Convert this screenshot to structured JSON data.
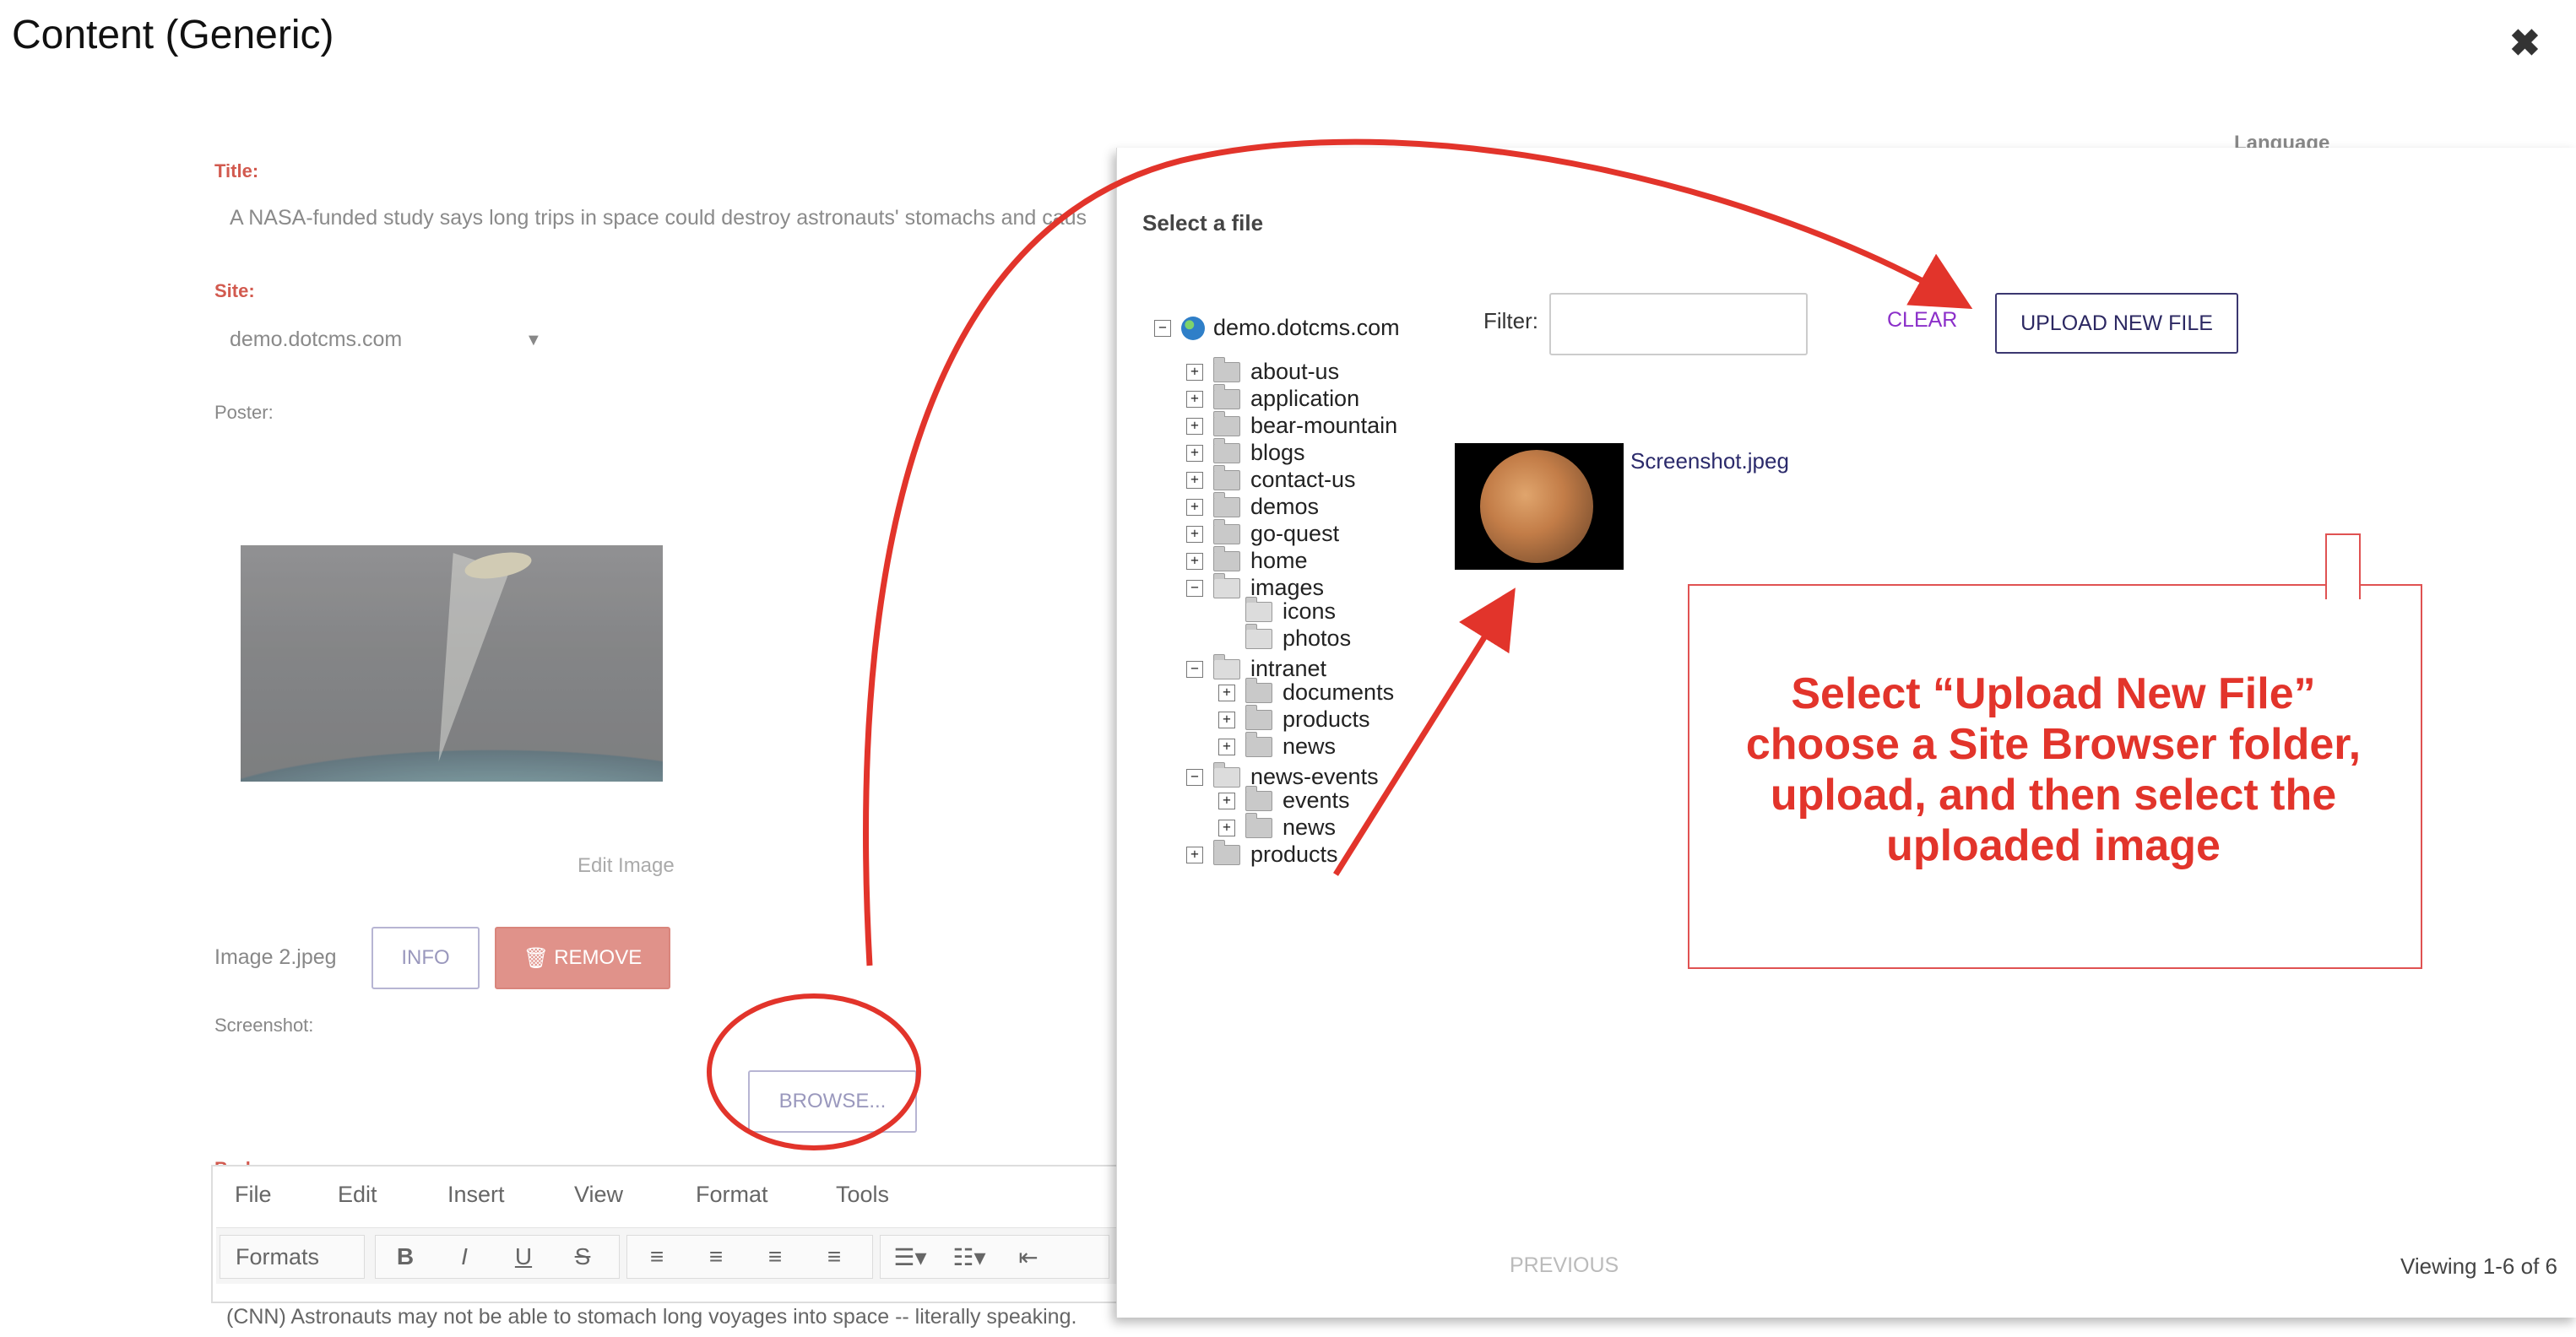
{
  "window": {
    "title": "Content (Generic)",
    "close_glyph": "✖"
  },
  "form": {
    "title_label": "Title:",
    "title_value": "A NASA-funded study says long trips in space could destroy astronauts' stomachs and caus",
    "site_label": "Site:",
    "site_value": "demo.dotcms.com",
    "poster_label": "Poster:",
    "edit_image": "Edit Image",
    "image_name": "Image 2.jpeg",
    "info_button": "INFO",
    "remove_button": "REMOVE",
    "screenshot_label": "Screenshot:",
    "browse_button": "BROWSE...",
    "body_label": "Body:",
    "language_label": "Language",
    "body_text": "(CNN) Astronauts may not be able to stomach long voyages into space -- literally speaking."
  },
  "editor": {
    "menus": [
      "File",
      "Edit",
      "Insert",
      "View",
      "Format",
      "Tools"
    ],
    "formats_label": "Formats",
    "buttons": [
      "B",
      "I",
      "U",
      "S"
    ],
    "align": [
      "≡",
      "≡",
      "≡",
      "≡"
    ]
  },
  "dialog": {
    "title": "Select a file",
    "filter_label": "Filter:",
    "filter_value": "",
    "clear_button": "CLEAR",
    "upload_button": "UPLOAD NEW FILE",
    "result_name": "Screenshot.jpeg",
    "previous_button": "PREVIOUS",
    "viewing": "Viewing 1-6 of 6",
    "tree": {
      "root": "demo.dotcms.com",
      "items": [
        {
          "label": "about-us",
          "toggle": "+"
        },
        {
          "label": "application",
          "toggle": "+"
        },
        {
          "label": "bear-mountain",
          "toggle": "+"
        },
        {
          "label": "blogs",
          "toggle": "+"
        },
        {
          "label": "contact-us",
          "toggle": "+"
        },
        {
          "label": "demos",
          "toggle": "+"
        },
        {
          "label": "go-quest",
          "toggle": "+"
        },
        {
          "label": "home",
          "toggle": "+"
        },
        {
          "label": "images",
          "toggle": "−"
        },
        {
          "label": "icons",
          "toggle": ""
        },
        {
          "label": "photos",
          "toggle": ""
        },
        {
          "label": "intranet",
          "toggle": "−"
        },
        {
          "label": "documents",
          "toggle": "+"
        },
        {
          "label": "products",
          "toggle": "+"
        },
        {
          "label": "news",
          "toggle": "+"
        },
        {
          "label": "news-events",
          "toggle": "−"
        },
        {
          "label": "events",
          "toggle": "+"
        },
        {
          "label": "news",
          "toggle": "+"
        },
        {
          "label": "products",
          "toggle": "+"
        }
      ]
    }
  },
  "annotation": {
    "callout_lines": [
      "Select “Upload New File”",
      "choose a Site Browser folder,",
      "upload, and then select the",
      "uploaded image"
    ],
    "color": "#e2342b"
  }
}
